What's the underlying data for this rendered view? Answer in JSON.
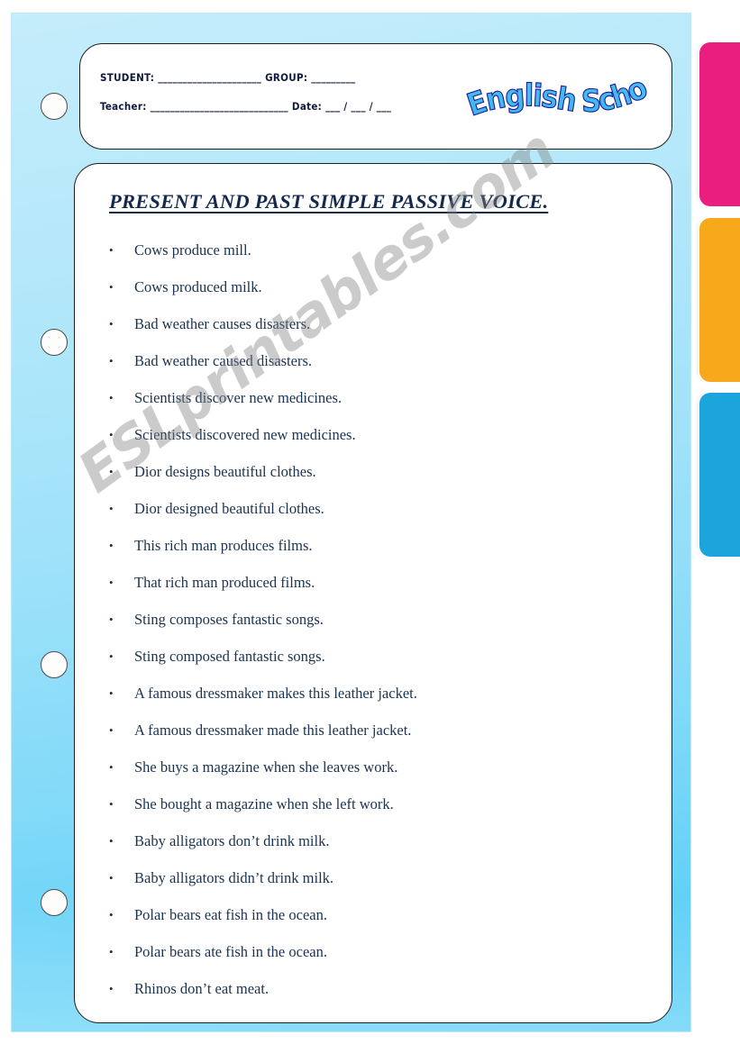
{
  "header": {
    "student_label": "STUDENT:",
    "student_line": "_____________________",
    "group_label": "GROUP:",
    "group_line": "_________",
    "teacher_label": "Teacher:",
    "teacher_line": "____________________________",
    "date_label": "Date:",
    "date_line": "___ / ___ / ___",
    "logo_text": "English School",
    "logo_colors": {
      "face": "#4cc0f0",
      "extrude": "#1a1a9e",
      "highlight": "#8fd9f7"
    }
  },
  "worksheet": {
    "title": "PRESENT AND PAST SIMPLE PASSIVE VOICE.",
    "bullet_glyph": "•",
    "items": [
      "Cows produce mill.",
      "Cows produced milk.",
      "Bad weather causes disasters.",
      "Bad weather caused disasters.",
      "Scientists discover new medicines.",
      "Scientists discovered new medicines.",
      "Dior designs beautiful clothes.",
      "Dior designed beautiful clothes.",
      "This rich man produces films.",
      "That rich man produced films.",
      "Sting composes fantastic songs.",
      "Sting composed fantastic songs.",
      "A famous dressmaker makes this leather jacket.",
      "A famous dressmaker made this leather jacket.",
      "She buys a magazine when she leaves work.",
      "She bought a magazine when she left work.",
      "Baby alligators don’t drink milk.",
      "Baby alligators didn’t drink milk.",
      "Polar bears eat fish in the ocean.",
      "Polar bears ate fish in the ocean.",
      "Rhinos don’t eat meat."
    ]
  },
  "watermark": {
    "text": "ESLprintables.com"
  },
  "decorations": {
    "tabs": [
      {
        "name": "pink",
        "color": "#E91E7E"
      },
      {
        "name": "orange",
        "color": "#F7A81B"
      },
      {
        "name": "blue",
        "color": "#1BA5DC"
      }
    ],
    "hole_count": 4,
    "panel_color_top": "#c5edfb",
    "panel_color_bottom": "#4ecbf6"
  }
}
